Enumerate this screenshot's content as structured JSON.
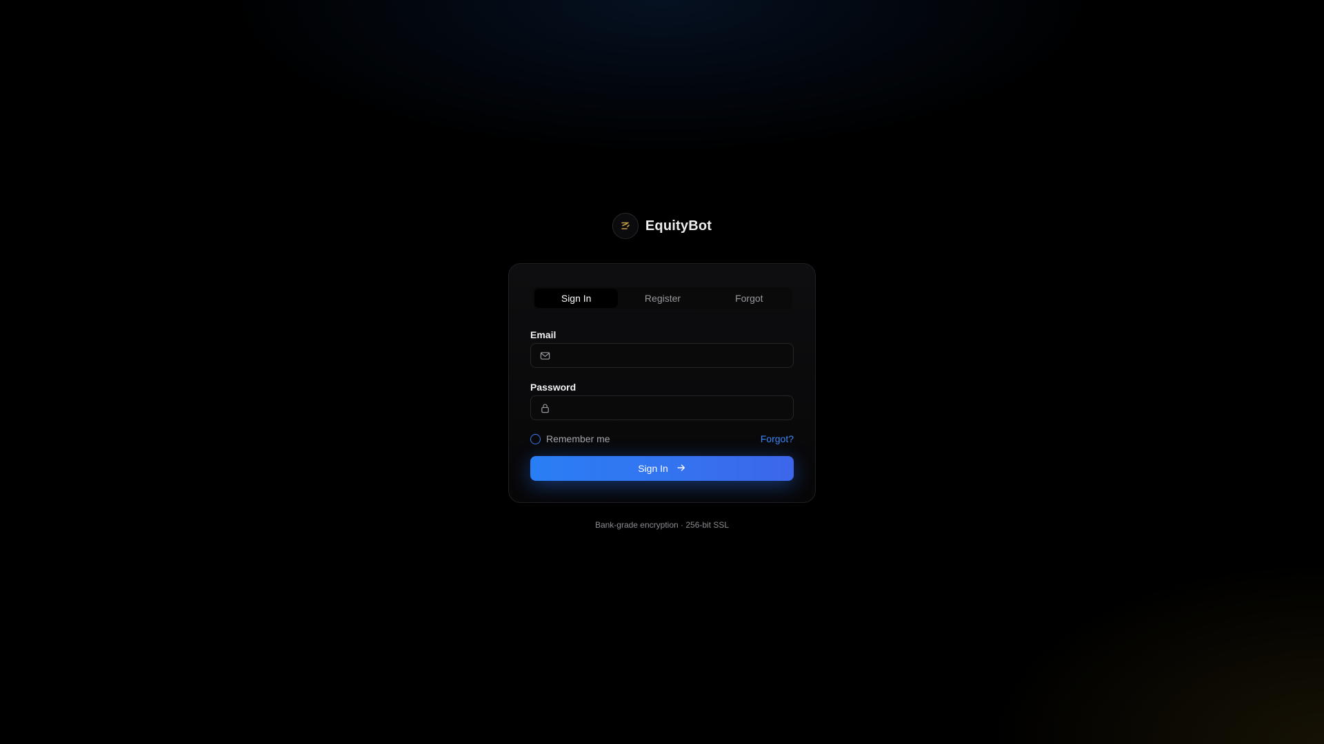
{
  "brand": {
    "name": "EquityBot",
    "logo_icon": "equitybot-logo-icon",
    "logo_color": "#c9a24a"
  },
  "tabs": [
    {
      "label": "Sign In",
      "active": true
    },
    {
      "label": "Register",
      "active": false
    },
    {
      "label": "Forgot",
      "active": false
    }
  ],
  "form": {
    "email": {
      "label": "Email",
      "value": "",
      "placeholder": "",
      "icon": "mail-icon"
    },
    "password": {
      "label": "Password",
      "value": "",
      "placeholder": "",
      "icon": "lock-icon"
    },
    "remember_label": "Remember me",
    "remember_checked": false,
    "forgot_link": "Forgot?",
    "submit_label": "Sign In"
  },
  "footer": {
    "note": "Bank-grade encryption · 256-bit SSL"
  },
  "colors": {
    "accent": "#2a7ef5",
    "link": "#3b86f5",
    "background": "#000000"
  }
}
